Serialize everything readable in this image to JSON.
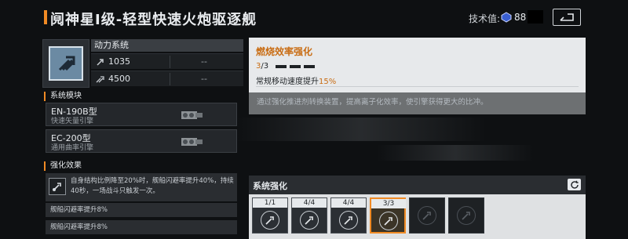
{
  "header": {
    "title": "阋神星Ⅰ级-轻型快速火炮驱逐舰",
    "tech_label": "技术值:",
    "tech_value": "88"
  },
  "module": {
    "name": "动力系统",
    "stats": [
      {
        "icon": "speed-icon",
        "value": "1035",
        "right": "--"
      },
      {
        "icon": "boost-icon",
        "value": "4500",
        "right": "--"
      }
    ]
  },
  "systems": {
    "heading": "系统模块",
    "items": [
      {
        "name": "EN-190B型",
        "sub": "快速矢量引擎"
      },
      {
        "name": "EC-200型",
        "sub": "通用曲率引擎"
      }
    ]
  },
  "effects": {
    "heading": "强化效果",
    "main": "自身结构比例降至20%时，舰船闪避率提升40%，持续40秒，一场战斗只触发一次。",
    "rows": [
      "舰船闪避率提升8%",
      "舰船闪避率提升8%"
    ]
  },
  "detail": {
    "title": "燃烧效率强化",
    "progress_current": "3",
    "progress_total": "/3",
    "effect_prefix": "常规移动速度提升",
    "effect_pct": "15%",
    "description": "通过强化推进剂转换装置，提高离子化效率，使引擎获得更大的比冲。"
  },
  "enhance": {
    "title": "系统强化",
    "slots": [
      {
        "count": "1/1",
        "state": "normal"
      },
      {
        "count": "4/4",
        "state": "normal"
      },
      {
        "count": "4/4",
        "state": "normal"
      },
      {
        "count": "3/3",
        "state": "active"
      },
      {
        "count": "",
        "state": "locked"
      },
      {
        "count": "",
        "state": "locked"
      }
    ]
  },
  "colors": {
    "accent": "#f08a24",
    "accent_text": "#c96d14"
  }
}
